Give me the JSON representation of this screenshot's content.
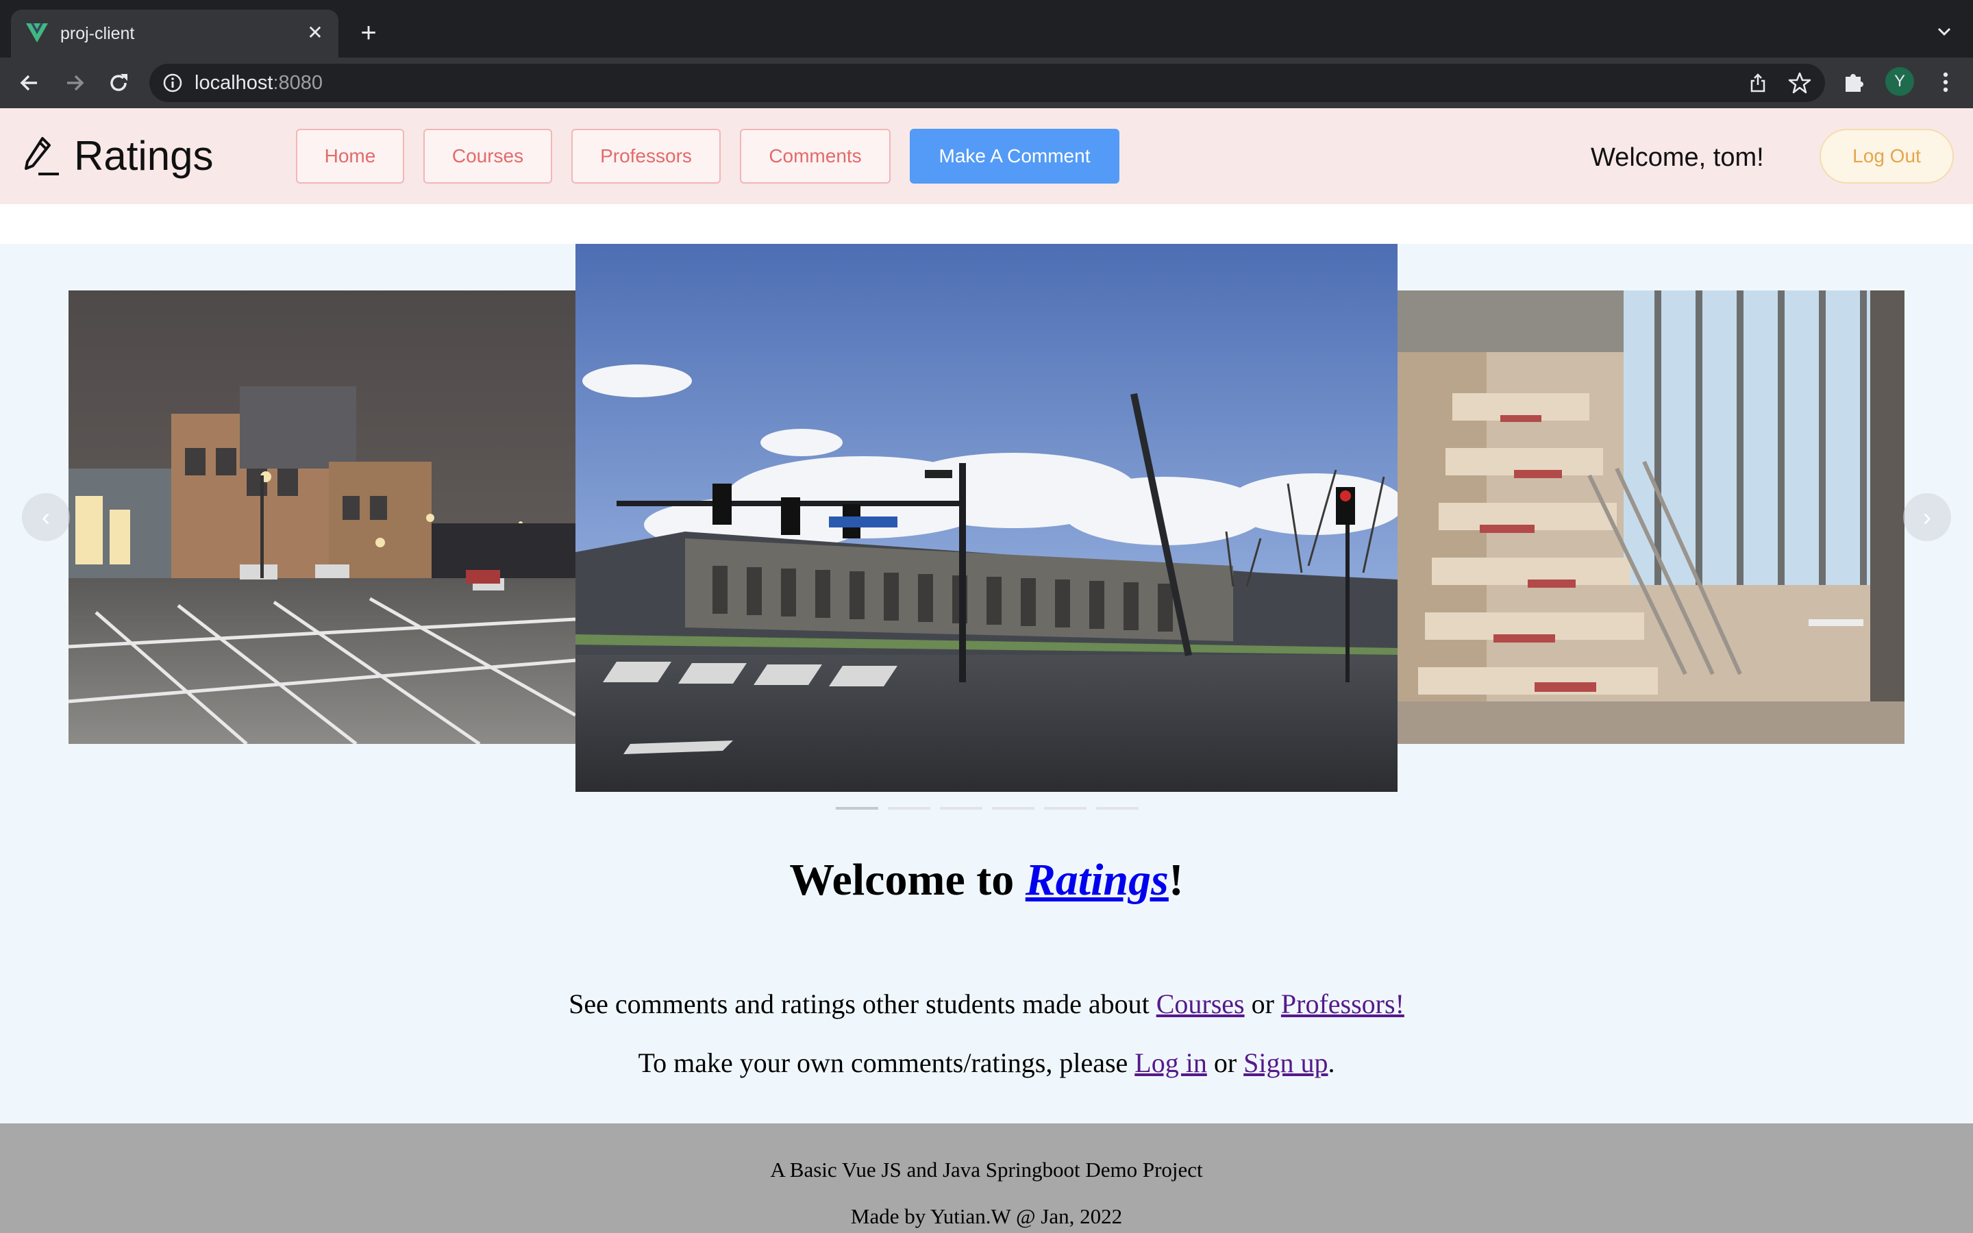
{
  "browser": {
    "tab_title": "proj-client",
    "url_host": "localhost",
    "url_port": ":8080",
    "profile_initial": "Y",
    "icons": [
      "vue-favicon",
      "close-icon",
      "plus-icon",
      "chevron-down-icon",
      "back-icon",
      "forward-icon",
      "reload-icon",
      "info-icon",
      "share-icon",
      "star-icon",
      "puzzle-icon",
      "kebab-menu-icon"
    ]
  },
  "header": {
    "app_name": "Ratings",
    "logo_icon": "pencil-icon",
    "nav": {
      "home": "Home",
      "courses": "Courses",
      "professors": "Professors",
      "comments": "Comments",
      "make_comment": "Make A Comment"
    },
    "welcome": "Welcome, tom!",
    "logout": "Log Out"
  },
  "carousel": {
    "slides": [
      "night-campus-parking-lot-photo",
      "campus-street-building-photo",
      "indoor-staircase-photo"
    ],
    "active_index": 0,
    "indicator_count": 6,
    "prev_label": "‹",
    "next_label": "›"
  },
  "hero": {
    "welcome_prefix": "Welcome to ",
    "brand": "Ratings",
    "welcome_suffix": "!",
    "line1_text": "See comments and ratings other students made about ",
    "line1_link1": "Courses",
    "line1_or": " or ",
    "line1_link2": "Professors!",
    "line2_text": "To make your own comments/ratings, please ",
    "line2_link1": "Log in",
    "line2_or": " or ",
    "line2_link2": "Sign up",
    "line2_end": "."
  },
  "footer": {
    "line1": "A Basic Vue JS and Java Springboot Demo Project",
    "line2": "Made by Yutian.W @ Jan, 2022"
  },
  "colors": {
    "header_bg": "#f9e8e8",
    "nav_text": "#e36a6a",
    "primary_button": "#539bf6",
    "logout_text": "#e4a64c",
    "page_bg": "#f0f7fc",
    "footer_bg": "#a8a8a8"
  }
}
